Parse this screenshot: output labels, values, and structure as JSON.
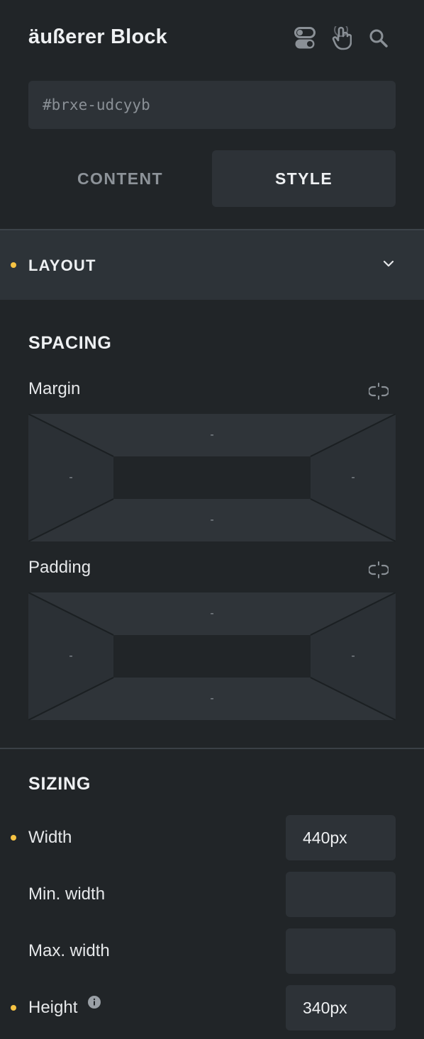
{
  "header": {
    "title": "äußerer Block",
    "icons": [
      "toggle-icon",
      "hand-pointer-icon",
      "search-icon"
    ]
  },
  "element_id": {
    "placeholder": "#brxe-udcyyb"
  },
  "tabs": [
    {
      "label": "CONTENT",
      "active": false
    },
    {
      "label": "STYLE",
      "active": true
    }
  ],
  "layout_group": {
    "label": "LAYOUT",
    "modified": true
  },
  "spacing": {
    "title": "SPACING",
    "margin": {
      "label": "Margin",
      "top": "-",
      "right": "-",
      "bottom": "-",
      "left": "-"
    },
    "padding": {
      "label": "Padding",
      "top": "-",
      "right": "-",
      "bottom": "-",
      "left": "-"
    }
  },
  "sizing": {
    "title": "SIZING",
    "rows": [
      {
        "label": "Width",
        "value": "440px",
        "modified": true
      },
      {
        "label": "Min. width",
        "value": "",
        "modified": false
      },
      {
        "label": "Max. width",
        "value": "",
        "modified": false
      },
      {
        "label": "Height",
        "value": "340px",
        "modified": true
      }
    ]
  },
  "colors": {
    "background": "#212528",
    "panel": "#2d3237",
    "accent_dot": "#f6c343"
  }
}
